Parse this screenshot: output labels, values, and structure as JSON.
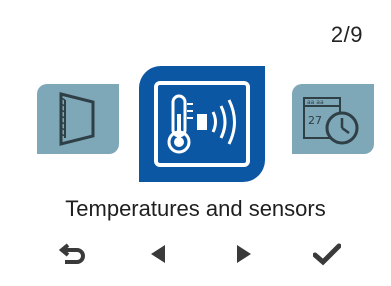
{
  "header": {
    "page_indicator": "2/9"
  },
  "carousel": {
    "left_tile": {
      "icon": "wall-panel-icon"
    },
    "center_tile": {
      "icon": "thermometer-sensor-icon",
      "selected": true
    },
    "right_tile": {
      "icon": "calendar-clock-icon"
    },
    "current_label": "Temperatures and sensors"
  },
  "nav": {
    "back_icon": "return-arrow-icon",
    "prev_icon": "triangle-left-icon",
    "next_icon": "triangle-right-icon",
    "confirm_icon": "checkmark-icon"
  },
  "colors": {
    "selected_tile": "#0b57a4",
    "side_tile": "#7ea7b8",
    "nav_icon": "#3a3a3a"
  }
}
